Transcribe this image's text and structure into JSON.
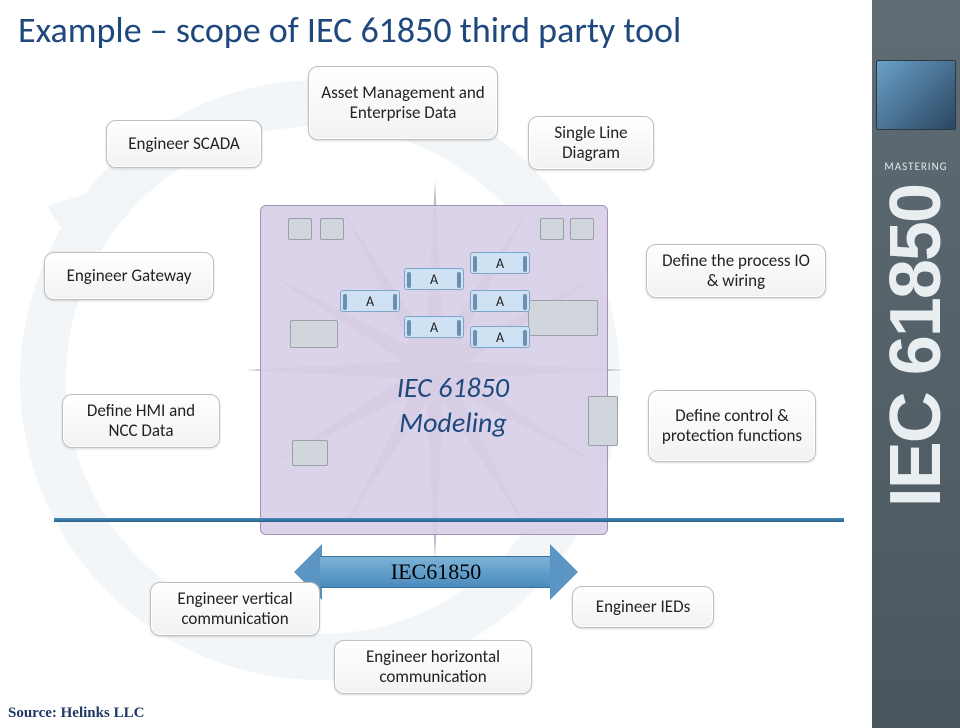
{
  "title": "Example – scope of IEC 61850 third party tool",
  "source": "Source: Helinks LLC",
  "sidebar": {
    "mastering": "MASTERING",
    "iec": "IEC 61850"
  },
  "center": {
    "modeling_line1": "IEC 61850",
    "modeling_line2": "Modeling",
    "bus_label": "IEC61850",
    "a_label": "A"
  },
  "labels": {
    "asset_mgmt": "Asset Management and Enterprise Data",
    "engineer_scada": "Engineer SCADA",
    "single_line": "Single Line Diagram",
    "engineer_gateway": "Engineer Gateway",
    "define_process": "Define the process IO & wiring",
    "define_hmi": "Define HMI and NCC Data",
    "define_control": "Define control & protection functions",
    "eng_vertical": "Engineer vertical communication",
    "engineer_ieds": "Engineer IEDs",
    "eng_horizontal": "Engineer horizontal communication"
  }
}
